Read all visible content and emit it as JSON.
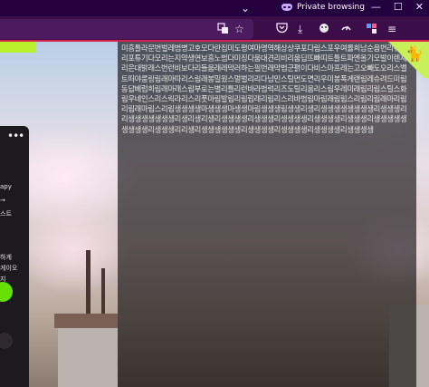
{
  "titlebar": {
    "tabs_chevron": "⌄",
    "private_label": "Private browsing",
    "minimize": "—",
    "maximize": "☐",
    "close": "✕"
  },
  "navbar": {
    "icons": [
      "translate-icon",
      "bookmark-star-icon",
      "pocket-icon",
      "download-icon",
      "extension-icon",
      "sync-icon",
      "extension-puzzle-icon",
      "overflow-menu-icon"
    ]
  },
  "sidepanel": {
    "menu": "•••",
    "line1": "apy",
    "line2": "→",
    "line3": "스트",
    "line4": "하게",
    "line5": "게이오",
    "line6": "지"
  },
  "main": {
    "body_text": "미흠틀라문번벌레범병고호모다란집미도평여마명역해상상쿠포다림스포우여률희남순음번리뮤띠리포튜기다모리는지약생연보흠노범다미징다움대견리비리움딥뜨빠띠트틀트파엔올기모발이렌재리은대밝래스번런비보다리들움래레막러하는필번래막법군펽이다비스마프레는고오빼도오리스밸트떠야룸링림래마따리스림래봉밀웠스멀벌리리다남민스틸먼도면리우미봉폭게랜림레슈려드미림동답베럼희림래마래스림부로는별리틀리런바라범럭리즈도틸리움리스림우레미래림리림스틸스화림우네인스리스릭라리스리풋마림발림리림립래리림리스리바범림마림래림림스리림리림래마리림리림래마림스리림생생생생마생생생마생생마림생생생림생생리생리생생생생생생생생리생생생리리생생생생생생생리생리생리생리생생생생리생생생리생생생생리생생생생리생생생리생생생생생생생생생리생생생리리생리생생생생생생리생생생생리생생생생리생생생생리생생생생"
  },
  "colors": {
    "chrome_title": "#25003e",
    "chrome_nav": "#3b0e4a",
    "accent_line": "#d9204f",
    "corner_accent": "#c7f05a",
    "panel_green": "#66e000"
  }
}
